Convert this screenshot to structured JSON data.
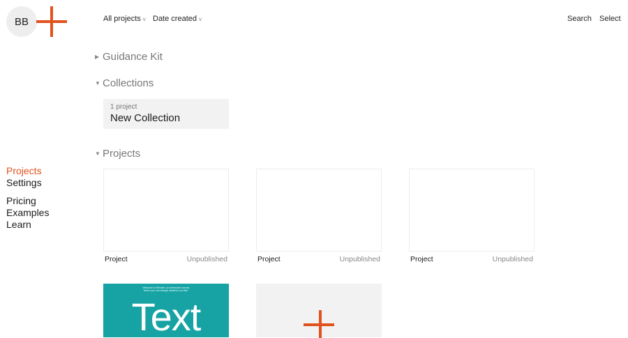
{
  "avatar": {
    "initials": "BB"
  },
  "logo": {
    "icon": "plus-logo-icon",
    "color": "#e0531f"
  },
  "filters": {
    "projects": {
      "label": "All projects",
      "caret": "v"
    },
    "sort": {
      "label": "Date created",
      "caret": "v"
    }
  },
  "top_actions": {
    "search": "Search",
    "select": "Select"
  },
  "sections": {
    "guidance": {
      "title": "Guidance Kit",
      "expanded": false
    },
    "collections": {
      "title": "Collections",
      "expanded": true
    },
    "projects": {
      "title": "Projects",
      "expanded": true
    }
  },
  "collection_card": {
    "count": "1 project",
    "name": "New Collection"
  },
  "nav": {
    "projects": "Projects",
    "settings": "Settings",
    "pricing": "Pricing",
    "examples": "Examples",
    "learn": "Learn"
  },
  "project_cards": [
    {
      "name": "Project",
      "status": "Unpublished"
    },
    {
      "name": "Project",
      "status": "Unpublished"
    },
    {
      "name": "Project",
      "status": "Unpublished"
    }
  ],
  "example_cards": [
    {
      "big_text": "Text",
      "tiny_line1": "Welcome to Reindex, an interactive canvas",
      "tiny_line2": "where you can change whatever you like.",
      "color": "#17a3a3"
    },
    {
      "icon": "plus-icon",
      "color": "#f2f2f2"
    }
  ],
  "colors": {
    "accent": "#e0531f",
    "card_bg": "#f2f2f2"
  }
}
